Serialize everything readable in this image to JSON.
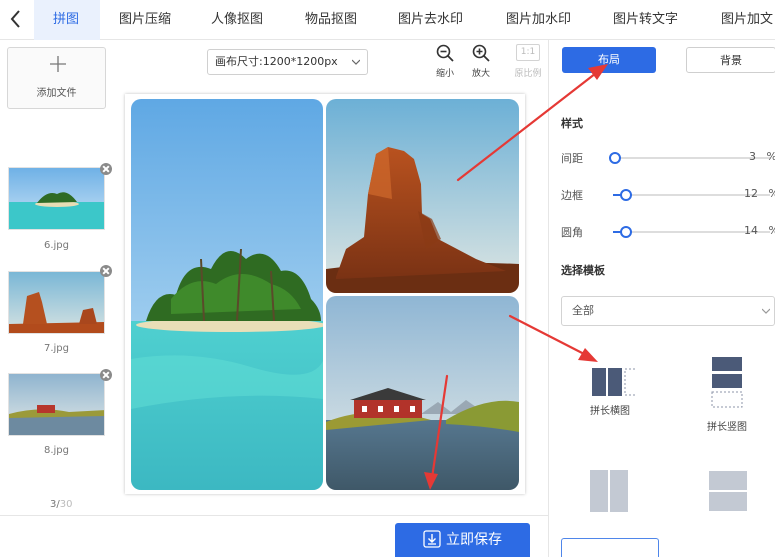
{
  "tabs": [
    {
      "label": "拼图",
      "active": true
    },
    {
      "label": "图片压缩",
      "active": false
    },
    {
      "label": "人像抠图",
      "active": false
    },
    {
      "label": "物品抠图",
      "active": false
    },
    {
      "label": "图片去水印",
      "active": false
    },
    {
      "label": "图片加水印",
      "active": false
    },
    {
      "label": "图片转文字",
      "active": false
    },
    {
      "label": "图片加文",
      "active": false
    }
  ],
  "files": {
    "add_label": "添加文件",
    "items": [
      {
        "name": "6.jpg",
        "scene": "island"
      },
      {
        "name": "7.jpg",
        "scene": "desert"
      },
      {
        "name": "8.jpg",
        "scene": "lake"
      }
    ],
    "pager": {
      "current": "3/",
      "total": "30"
    }
  },
  "canvas": {
    "size_label": "画布尺寸:1200*1200px",
    "zoom_out": "缩小",
    "zoom_in": "放大",
    "ratio_box": "1:1",
    "ratio_label": "原比例"
  },
  "save_label": "立即保存",
  "panel": {
    "tab_layout": "布局",
    "tab_background": "背景",
    "style_title": "样式",
    "sliders": [
      {
        "name": "间距",
        "value": 3,
        "unit": "%"
      },
      {
        "name": "边框",
        "value": 12,
        "unit": "%"
      },
      {
        "name": "圆角",
        "value": 14,
        "unit": "%"
      }
    ],
    "template_title": "选择模板",
    "template_select": "全部",
    "templates": [
      {
        "label": "拼长横图"
      },
      {
        "label": "拼长竖图"
      },
      {
        "label": ""
      },
      {
        "label": ""
      }
    ]
  },
  "colors": {
    "accent": "#2d6be4",
    "arrow": "#e53935"
  }
}
